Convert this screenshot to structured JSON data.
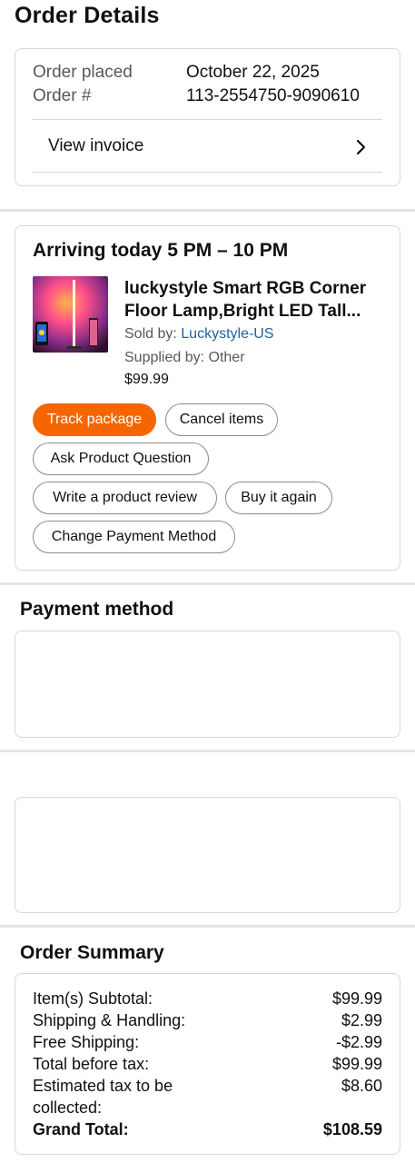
{
  "page_title": "Order Details",
  "order_info": {
    "placed_label": "Order placed",
    "placed_value": "October 22, 2025",
    "number_label": "Order #",
    "number_value": "113-2554750-9090610",
    "invoice_label": "View invoice",
    "invoice_icon": "chevron-right-icon"
  },
  "shipment": {
    "arriving": "Arriving today 5 PM – 10 PM",
    "product_title_line1": "luckystyle Smart RGB Corner",
    "product_title_line2": "Floor Lamp,Bright LED Tall...",
    "sold_by_label": "Sold by: ",
    "sold_by_value": "Luckystyle-US",
    "supplied_by": "Supplied by: Other",
    "price": "$99.99",
    "buttons": {
      "track": "Track package",
      "cancel": "Cancel items",
      "ask": "Ask Product Question",
      "review": "Write a product review",
      "buy_again": "Buy it again",
      "change_payment": "Change Payment Method"
    }
  },
  "payment_title": "Payment method",
  "summary": {
    "title": "Order Summary",
    "rows": [
      {
        "label": "Item(s) Subtotal:",
        "value": "$99.99"
      },
      {
        "label": "Shipping & Handling:",
        "value": "$2.99"
      },
      {
        "label": "Free Shipping:",
        "value": "-$2.99"
      },
      {
        "label": "Total before tax:",
        "value": "$99.99"
      },
      {
        "label": "Estimated tax to be",
        "value": "$8.60"
      },
      {
        "label": "collected:",
        "value": ""
      }
    ],
    "grand_label": "Grand Total:",
    "grand_value": "$108.59"
  },
  "colors": {
    "primary_button": "#f56600",
    "link": "#2162a1",
    "border": "#d5d9d9"
  }
}
